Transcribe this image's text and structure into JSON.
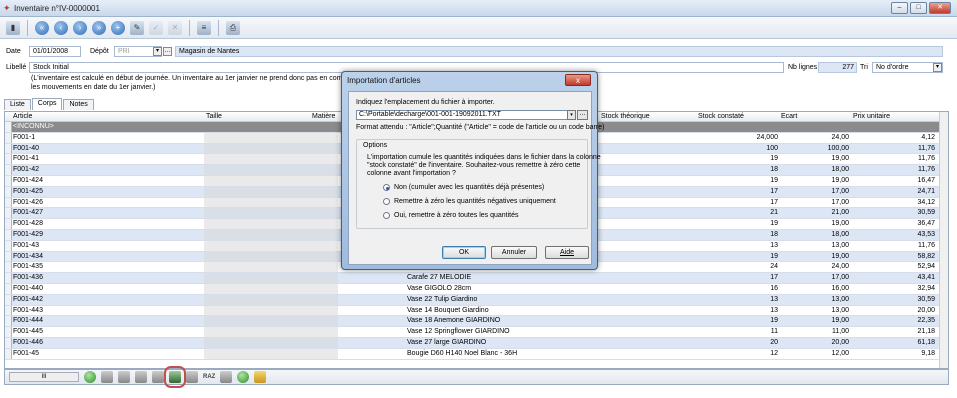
{
  "window": {
    "title": "Inventaire n°IV-0000001"
  },
  "form": {
    "date_label": "Date",
    "date_value": "01/01/2008",
    "depot_label": "Dépôt",
    "depot_value": "PRI",
    "depot_name": "Magasin de Nantes",
    "libelle_label": "Libellé",
    "libelle_value": "Stock Initial",
    "nb_lignes_label": "Nb lignes",
    "nb_lignes_value": "277",
    "tri_label": "Tri",
    "tri_value": "No d'ordre",
    "info_line1": "(L'inventaire est calculé en début de journée. Un inventaire au 1er janvier ne prend donc pas en compte",
    "info_line2": "les mouvements en date du 1er janvier.)"
  },
  "tabs": [
    {
      "label": "Liste"
    },
    {
      "label": "Corps"
    },
    {
      "label": "Notes"
    }
  ],
  "grid": {
    "headers": {
      "article": "Article",
      "taille": "Taille",
      "matiere": "Matière",
      "stock_theorique": "Stock théorique",
      "stock_constate": "Stock constaté",
      "ecart": "Ecart",
      "prix": "Prix unitaire"
    },
    "rows": [
      {
        "article": "<INCONNU>",
        "designation": "",
        "stock": "",
        "ecart": "",
        "prix": ""
      },
      {
        "article": "F001-1",
        "designation": "",
        "stock": "24,000",
        "ecart": "24,00",
        "prix": "4,12"
      },
      {
        "article": "F001-40",
        "designation": "",
        "stock": "100",
        "ecart": "100,00",
        "prix": "11,76"
      },
      {
        "article": "F001-41",
        "designation": "",
        "stock": "19",
        "ecart": "19,00",
        "prix": "11,76"
      },
      {
        "article": "F001-42",
        "designation": "",
        "stock": "18",
        "ecart": "18,00",
        "prix": "11,76"
      },
      {
        "article": "F001-424",
        "designation": "",
        "stock": "19",
        "ecart": "19,00",
        "prix": "16,47"
      },
      {
        "article": "F001-425",
        "designation": "",
        "stock": "17",
        "ecart": "17,00",
        "prix": "24,71"
      },
      {
        "article": "F001-426",
        "designation": "",
        "stock": "17",
        "ecart": "17,00",
        "prix": "34,12"
      },
      {
        "article": "F001-427",
        "designation": "",
        "stock": "21",
        "ecart": "21,00",
        "prix": "30,59"
      },
      {
        "article": "F001-428",
        "designation": "",
        "stock": "19",
        "ecart": "19,00",
        "prix": "36,47"
      },
      {
        "article": "F001-429",
        "designation": "",
        "stock": "18",
        "ecart": "18,00",
        "prix": "43,53"
      },
      {
        "article": "F001-43",
        "designation": "",
        "stock": "13",
        "ecart": "13,00",
        "prix": "11,76"
      },
      {
        "article": "F001-434",
        "designation": "",
        "stock": "19",
        "ecart": "19,00",
        "prix": "58,82"
      },
      {
        "article": "F001-435",
        "designation": "",
        "stock": "24",
        "ecart": "24,00",
        "prix": "52,94"
      },
      {
        "article": "F001-436",
        "designation": "Carafe 27 MELODIE",
        "stock": "17",
        "ecart": "17,00",
        "prix": "43,41"
      },
      {
        "article": "F001-440",
        "designation": "Vase GIGOLO 28cm",
        "stock": "16",
        "ecart": "16,00",
        "prix": "32,94"
      },
      {
        "article": "F001-442",
        "designation": "Vase 22 Tulip Giardino",
        "stock": "13",
        "ecart": "13,00",
        "prix": "30,59"
      },
      {
        "article": "F001-443",
        "designation": "Vase 14 Bouquet Giardino",
        "stock": "13",
        "ecart": "13,00",
        "prix": "20,00"
      },
      {
        "article": "F001-444",
        "designation": "Vase 18 Anemone GIARDINO",
        "stock": "19",
        "ecart": "19,00",
        "prix": "22,35"
      },
      {
        "article": "F001-445",
        "designation": "Vase 12 Springflower GIARDINO",
        "stock": "11",
        "ecart": "11,00",
        "prix": "21,18"
      },
      {
        "article": "F001-446",
        "designation": "Vase 27 large GIARDINO",
        "stock": "20",
        "ecart": "20,00",
        "prix": "61,18"
      },
      {
        "article": "F001-45",
        "designation": "Bougie D60 H140 Noel Blanc - 36H",
        "stock": "12",
        "ecart": "12,00",
        "prix": "9,18"
      }
    ]
  },
  "bottom": {
    "raz_label": "RAZ",
    "scroll_label": "III"
  },
  "dialog": {
    "title": "Importation d'articles",
    "close_label": "x",
    "prompt": "Indiquez l'emplacement du fichier à importer.",
    "path": "C:\\Portable\\decharge\\001-001-19092011.TXT",
    "browse_label": "...",
    "format_text": "Format attendu : \"Article\";Quantité (\"Article\" = code de l'article ou un code barre)",
    "options_legend": "Options",
    "options_text1": "L'importation cumule les quantités indiquées dans le fichier dans la colonne",
    "options_text2": "\"stock constaté\" de l'inventaire. Souhaitez-vous remettre à zéro cette",
    "options_text3": "colonne avant l'importation ?",
    "radio1": "Non (cumuler avec les quantités déjà présentes)",
    "radio2": "Remettre à zéro les quantités négatives uniquement",
    "radio3": "Oui, remettre à zéro toutes les quantités",
    "ok_label": "OK",
    "cancel_label": "Annuler",
    "help_label": "Aide"
  },
  "colors": {
    "accent": "#2f6db3",
    "row_alt": "#dce6f4",
    "highlight": "#c0504d"
  }
}
